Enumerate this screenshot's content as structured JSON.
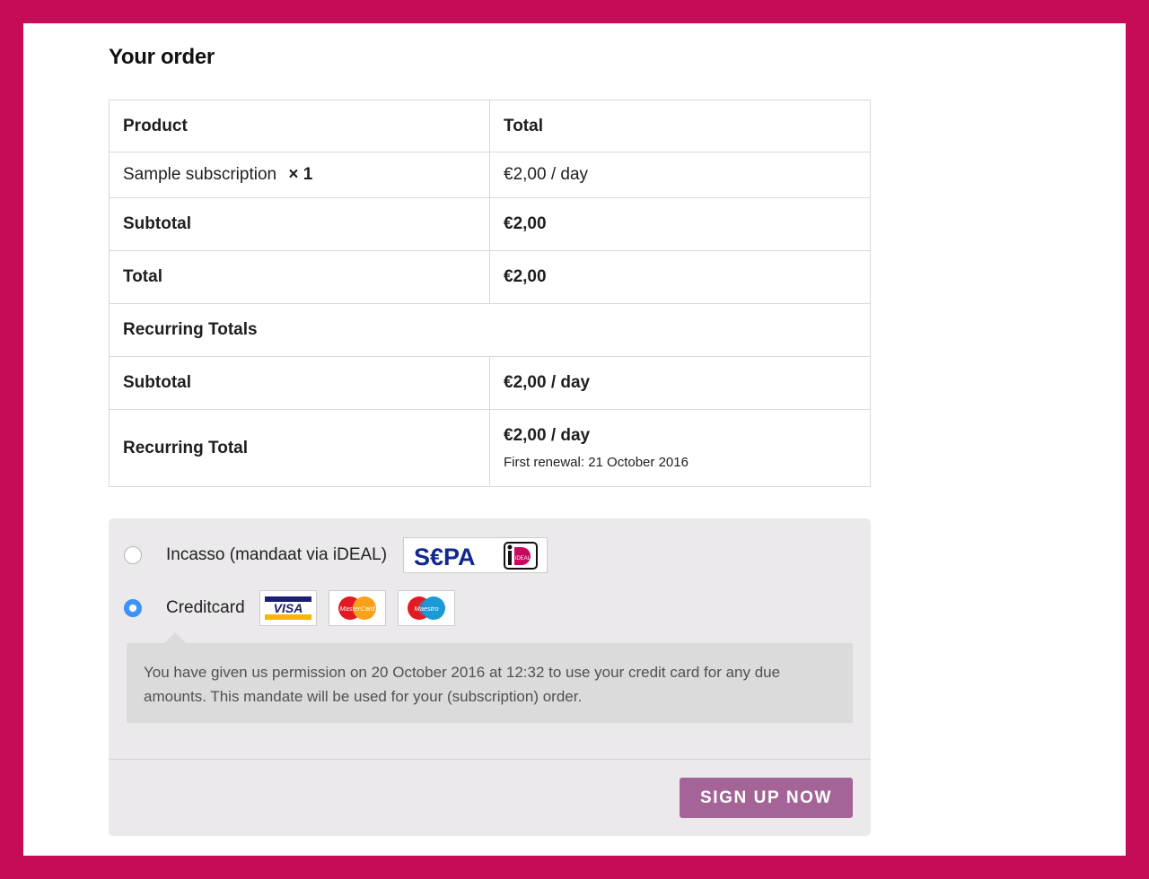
{
  "heading": "Your order",
  "table": {
    "col_product": "Product",
    "col_total": "Total",
    "item_name": "Sample subscription",
    "item_qty": "× 1",
    "item_price": "€2,00 / day",
    "subtotal_label": "Subtotal",
    "subtotal_value": "€2,00",
    "total_label": "Total",
    "total_value": "€2,00",
    "recurring_heading": "Recurring Totals",
    "recurring_subtotal_label": "Subtotal",
    "recurring_subtotal_value": "€2,00 / day",
    "recurring_total_label": "Recurring Total",
    "recurring_total_value": "€2,00 / day",
    "first_renewal": "First renewal: 21 October 2016"
  },
  "payment": {
    "methods": [
      {
        "label": "Incasso (mandaat via iDEAL)",
        "checked": false,
        "icons": [
          "sepa-logo",
          "ideal-logo"
        ]
      },
      {
        "label": "Creditcard",
        "checked": true,
        "icons": [
          "visa-logo",
          "mastercard-logo",
          "maestro-logo"
        ]
      }
    ],
    "sepa_text": "S€PA",
    "ideal_text": "iD",
    "visa_text": "VISA",
    "mastercard_text": "MasterCard",
    "maestro_text": "Maestro",
    "mandate_text": "You have given us permission on 20 October 2016 at 12:32 to use your credit card for any due amounts. This mandate will be used for your (subscription) order.",
    "submit_label": "SIGN UP NOW"
  },
  "colors": {
    "frame": "#c60c56",
    "button": "#a46497",
    "radio_checked": "#3b93f7"
  }
}
